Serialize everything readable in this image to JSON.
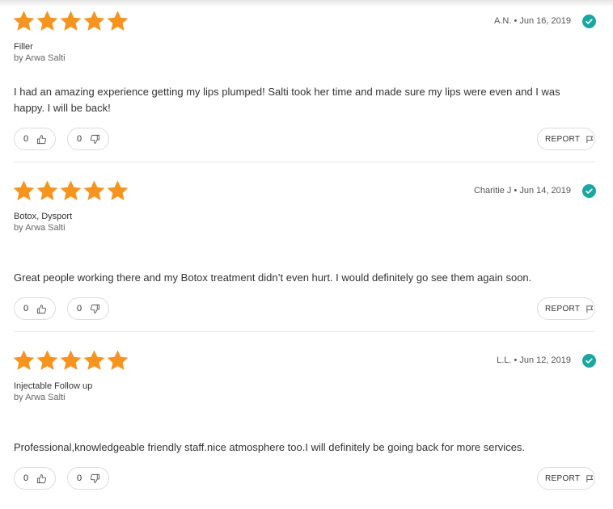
{
  "colors": {
    "star": "#f7941d",
    "verified": "#1aa7a1",
    "divider": "#e6e6e6"
  },
  "icons": {
    "star": "star-icon",
    "verified": "check-circle-icon",
    "upvote": "thumbs-up-icon",
    "downvote": "thumbs-down-icon",
    "report": "flag-icon"
  },
  "reviews": [
    {
      "rating": 5,
      "reviewer": "A.N.",
      "date": "Jun 16, 2019",
      "meta": "A.N. • Jun 16, 2019",
      "treatment": "Filler",
      "author": "by Arwa Salti",
      "body": "I had an amazing experience getting my lips plumped! Salti took her time and made sure my lips were even and I was happy. I will be back!",
      "upvotes": "0",
      "downvotes": "0",
      "report_label": "REPORT"
    },
    {
      "rating": 5,
      "reviewer": "Charitie J",
      "date": "Jun 14, 2019",
      "meta": "Charitie J • Jun 14, 2019",
      "treatment": "Botox, Dysport",
      "author": "by Arwa Salti",
      "body": "Great people working there and my Botox treatment didn’t even hurt. I would definitely go see them again soon.",
      "upvotes": "0",
      "downvotes": "0",
      "report_label": "REPORT"
    },
    {
      "rating": 5,
      "reviewer": "L.L.",
      "date": "Jun 12, 2019",
      "meta": "L.L. • Jun 12, 2019",
      "treatment": "Injectable Follow up",
      "author": "by Arwa Salti",
      "body": "Professional,knowledgeable friendly staff.nice atmosphere too.I will definitely be going back for more services.",
      "upvotes": "0",
      "downvotes": "0",
      "report_label": "REPORT"
    }
  ]
}
